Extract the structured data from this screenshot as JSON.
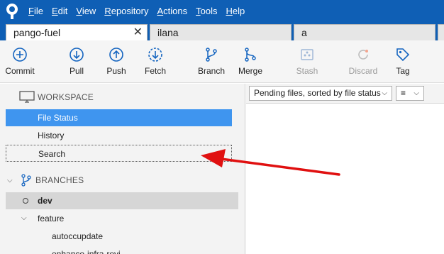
{
  "menu": {
    "items": [
      {
        "u": "F",
        "rest": "ile"
      },
      {
        "u": "E",
        "rest": "dit"
      },
      {
        "u": "V",
        "rest": "iew"
      },
      {
        "u": "R",
        "rest": "epository"
      },
      {
        "u": "A",
        "rest": "ctions"
      },
      {
        "u": "T",
        "rest": "ools"
      },
      {
        "u": "H",
        "rest": "elp"
      }
    ]
  },
  "tabs": [
    {
      "label": "pango-fuel",
      "active": true,
      "close": "✕"
    },
    {
      "label": "ilana",
      "active": false
    },
    {
      "label": "a",
      "active": false
    }
  ],
  "toolbar": {
    "commit": "Commit",
    "pull": "Pull",
    "push": "Push",
    "fetch": "Fetch",
    "branch": "Branch",
    "merge": "Merge",
    "stash": "Stash",
    "discard": "Discard",
    "tag": "Tag"
  },
  "sidebar": {
    "workspace_header": "WORKSPACE",
    "workspace_items": [
      "File Status",
      "History",
      "Search"
    ],
    "branches_header": "BRANCHES",
    "branches": {
      "current": "dev",
      "folder": "feature",
      "children": [
        "autoccupdate",
        "enhance-infra-revi"
      ]
    }
  },
  "files_panel": {
    "sort_dropdown": "Pending files, sorted by file status",
    "view_dropdown_icon": "list-icon"
  },
  "colors": {
    "menubar": "#0f5fb5",
    "selection": "#3f95ef",
    "arrow": "#e01010"
  }
}
